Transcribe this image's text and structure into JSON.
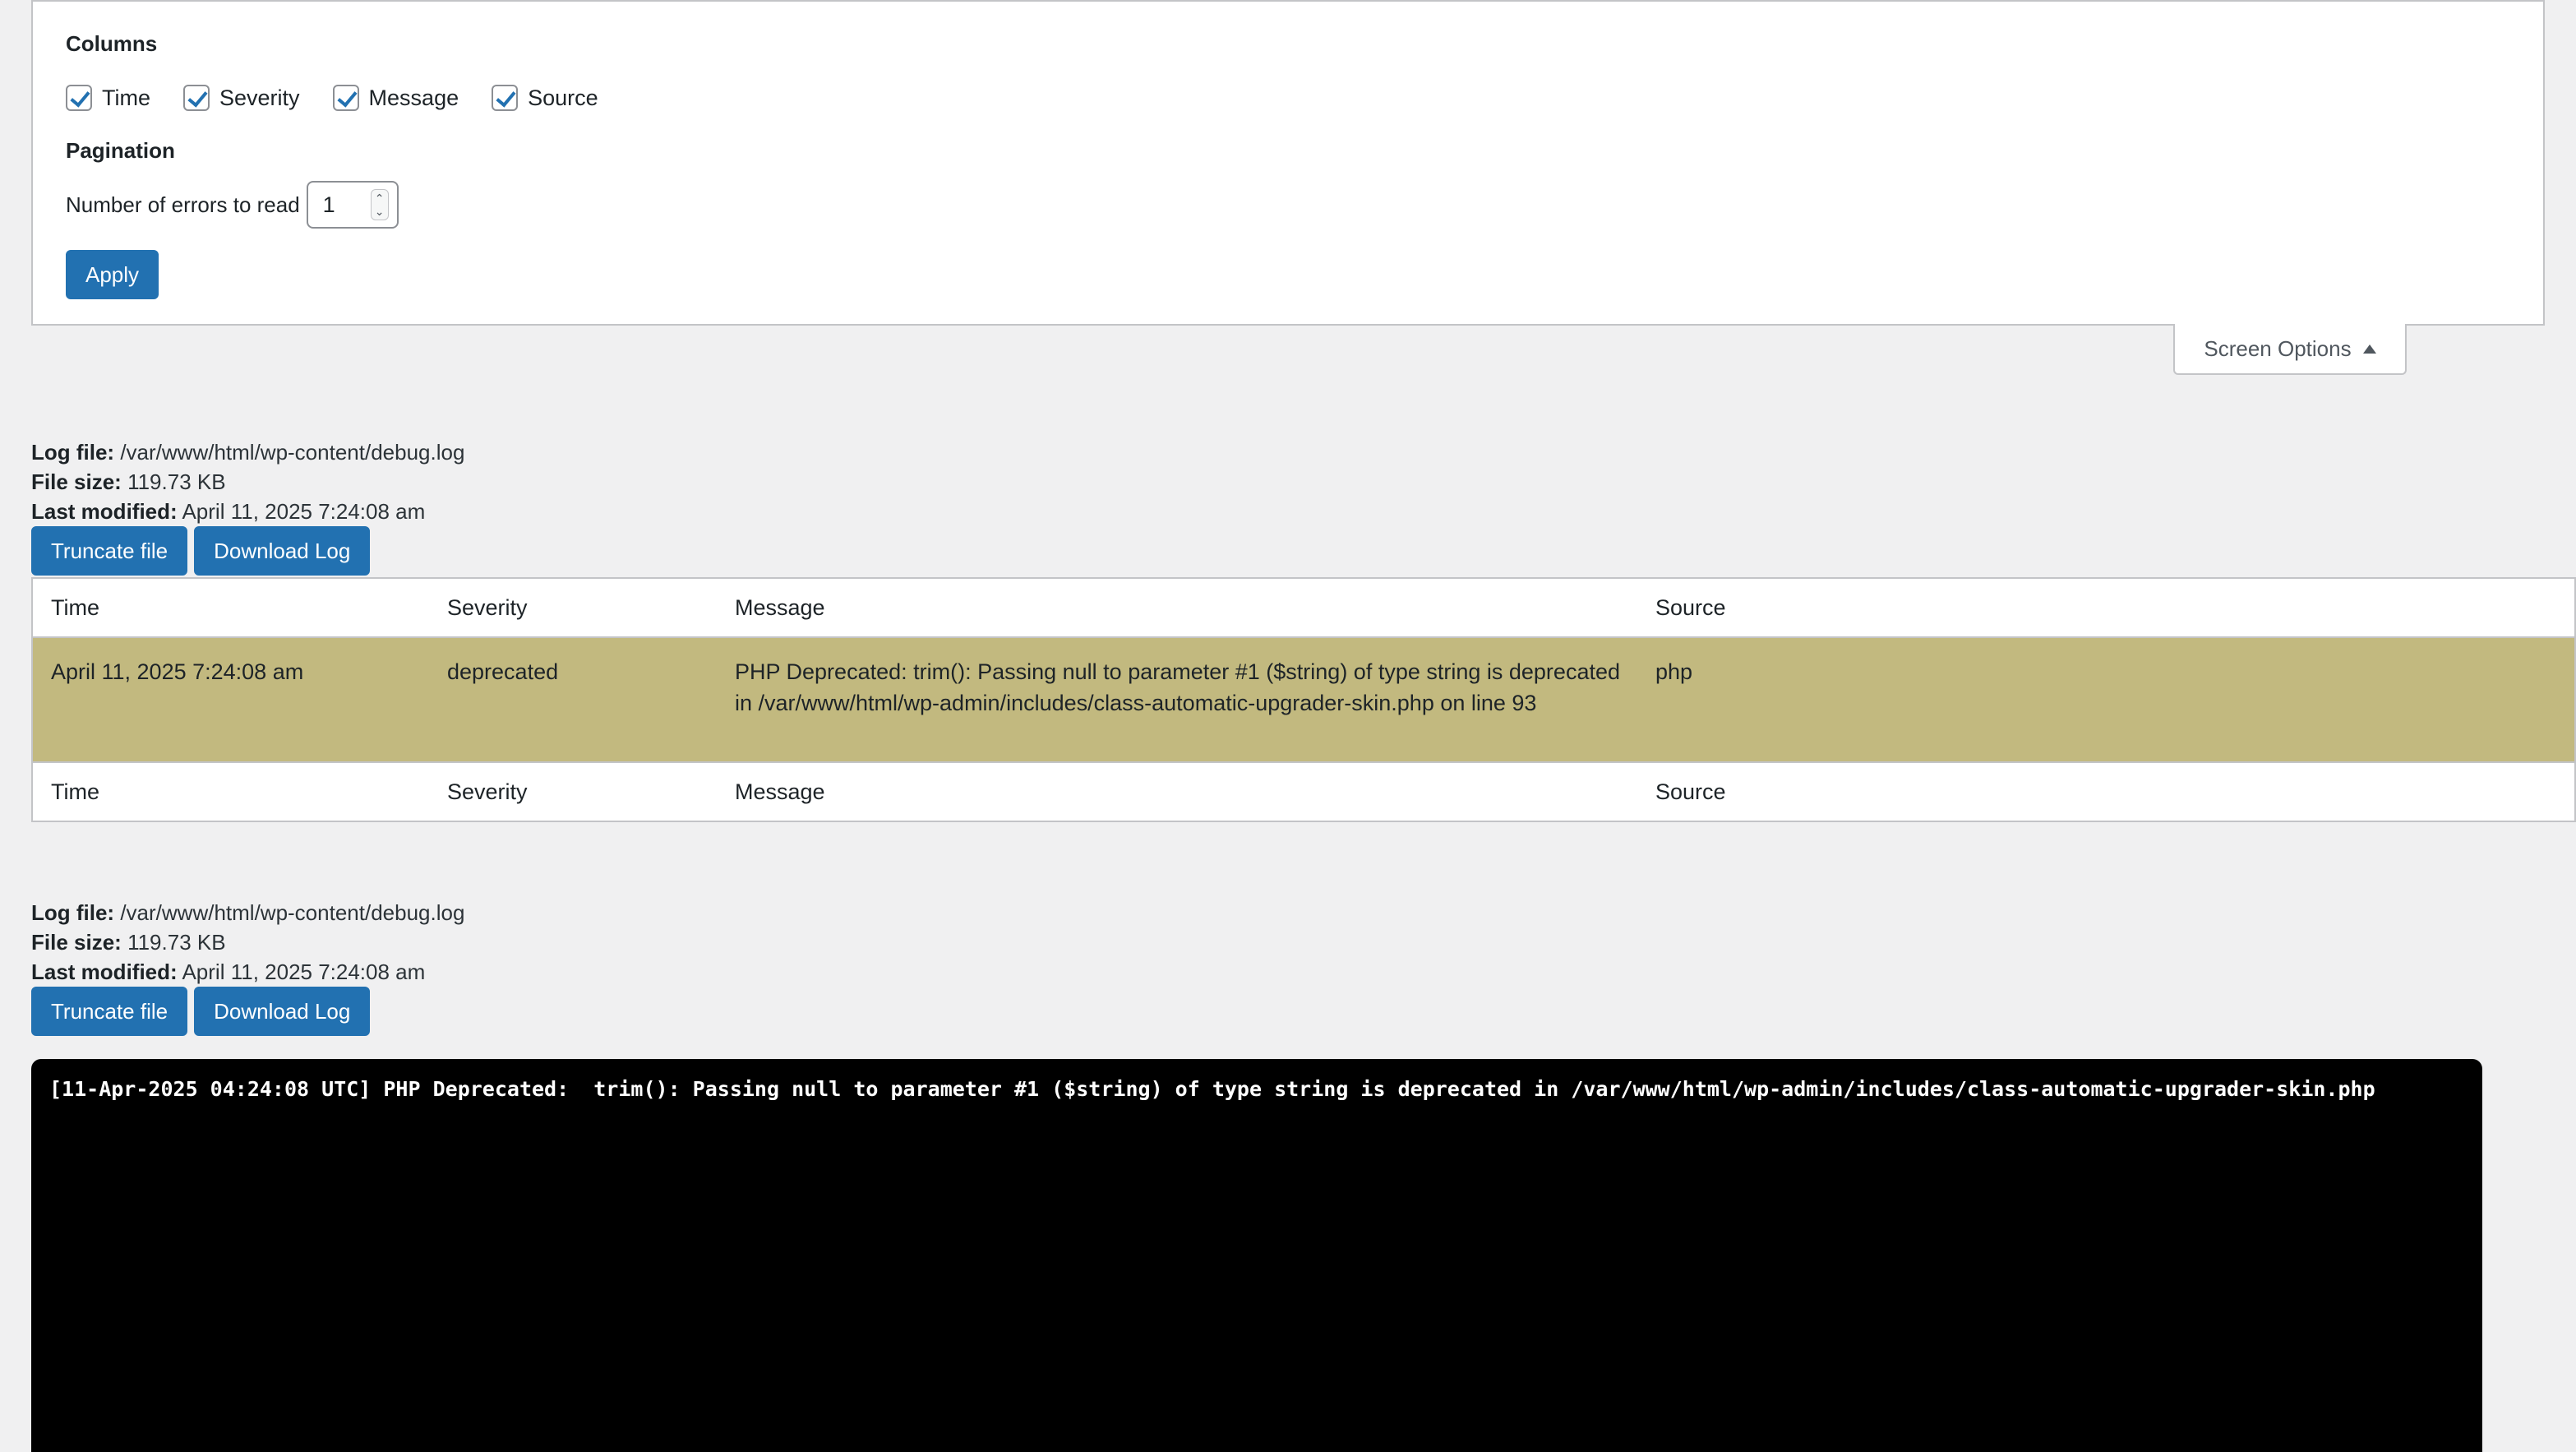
{
  "screen_options": {
    "columns_title": "Columns",
    "columns": [
      {
        "label": "Time",
        "checked": true
      },
      {
        "label": "Severity",
        "checked": true
      },
      {
        "label": "Message",
        "checked": true
      },
      {
        "label": "Source",
        "checked": true
      }
    ],
    "pagination_title": "Pagination",
    "errors_to_read_label": "Number of errors to read",
    "errors_to_read_value": "1",
    "apply_label": "Apply",
    "tab_label": "Screen Options"
  },
  "log_block_1": {
    "log_file_label": "Log file:",
    "log_file_value": "/var/www/html/wp-content/debug.log",
    "file_size_label": "File size:",
    "file_size_value": "119.73 KB",
    "last_modified_label": "Last modified:",
    "last_modified_value": "April 11, 2025 7:24:08 am",
    "truncate_label": "Truncate file",
    "download_label": "Download Log"
  },
  "table": {
    "headers": [
      "Time",
      "Severity",
      "Message",
      "Source"
    ],
    "rows": [
      {
        "time": "April 11, 2025 7:24:08 am",
        "severity": "deprecated",
        "message": "PHP Deprecated: trim(): Passing null to parameter #1 ($string) of type string is deprecated in /var/www/html/wp-admin/includes/class-automatic-upgrader-skin.php on line 93",
        "source": "php"
      }
    ],
    "row_color": "#c2b97f"
  },
  "log_block_2": {
    "log_file_label": "Log file:",
    "log_file_value": "/var/www/html/wp-content/debug.log",
    "file_size_label": "File size:",
    "file_size_value": "119.73 KB",
    "last_modified_label": "Last modified:",
    "last_modified_value": "April 11, 2025 7:24:08 am",
    "truncate_label": "Truncate file",
    "download_label": "Download Log"
  },
  "raw_log": {
    "line": "[11-Apr-2025 04:24:08 UTC] PHP Deprecated:  trim(): Passing null to parameter #1 ($string) of type string is deprecated in /var/www/html/wp-admin/includes/class-automatic-upgrader-skin.php"
  },
  "colors": {
    "accent": "#2271b1",
    "background": "#f0f0f1",
    "terminal": "#000000"
  }
}
